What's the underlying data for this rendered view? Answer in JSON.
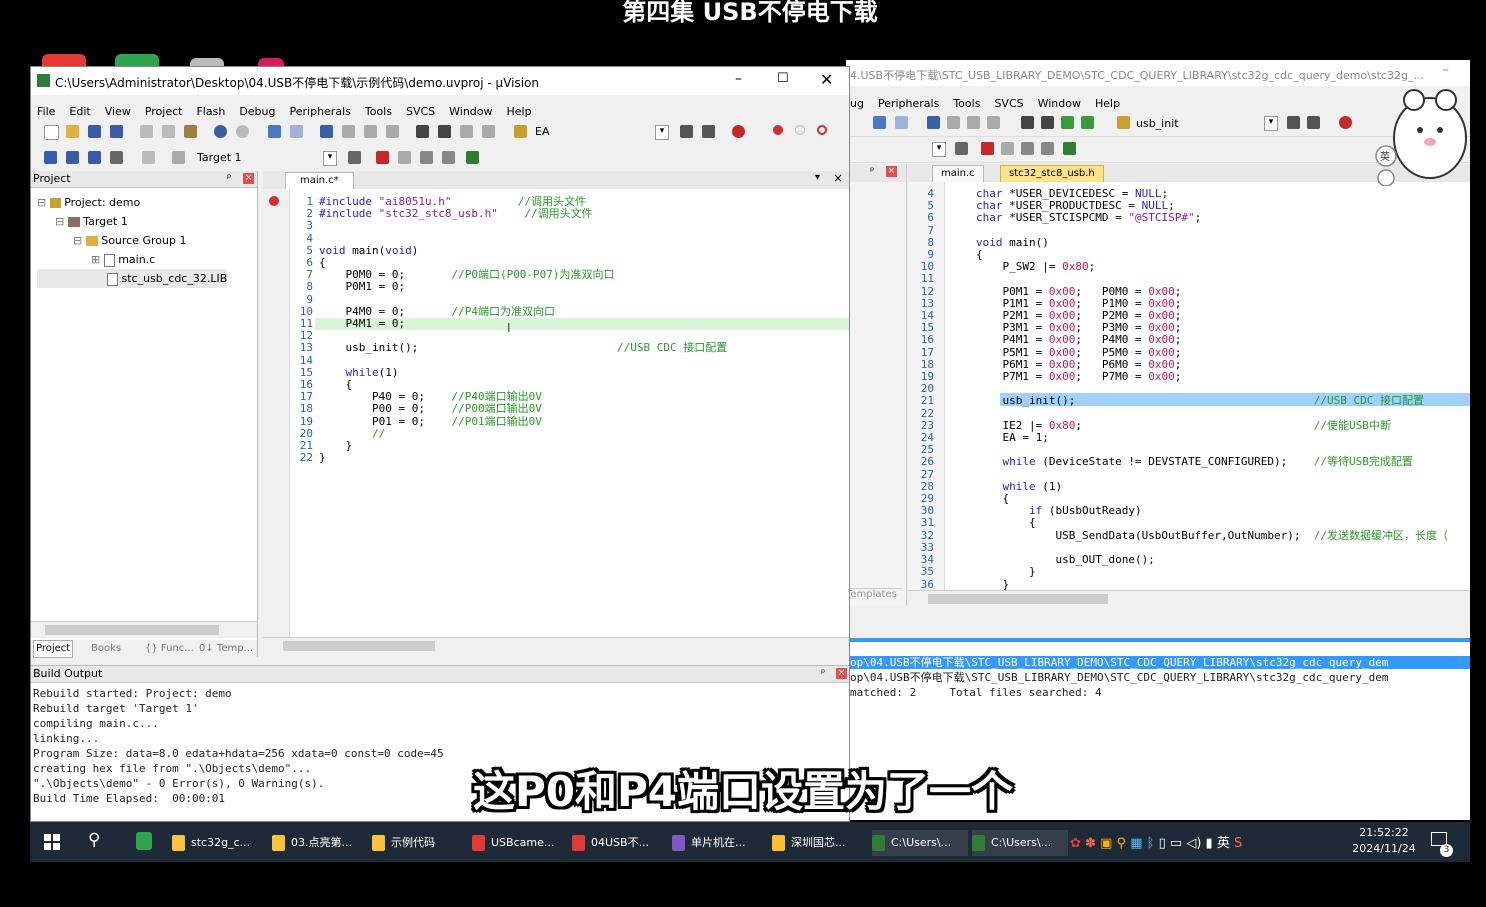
{
  "video_title": "第四集 USB不停电下载",
  "subtitle": "这P0和P4端口设置为了一个",
  "left_window": {
    "title": "C:\\Users\\Administrator\\Desktop\\04.USB不停电下载\\示例代码\\demo.uvproj - µVision",
    "menu": [
      "File",
      "Edit",
      "View",
      "Project",
      "Flash",
      "Debug",
      "Peripherals",
      "Tools",
      "SVCS",
      "Window",
      "Help"
    ],
    "toolbar_combo": "EA",
    "target_combo": "Target 1",
    "project_panel_title": "Project",
    "tree": [
      "Project: demo",
      "Target 1",
      "Source Group 1",
      "main.c",
      "stc_usb_cdc_32.LIB"
    ],
    "bottom_tabs": [
      "Project",
      "Books",
      "{} Func...",
      "0↓ Temp..."
    ],
    "editor_tab": "main.c*",
    "code_lines": [
      {
        "n": "1",
        "t": "#include \"ai8051u.h\"          //调用头文件"
      },
      {
        "n": "2",
        "t": "#include \"stc32_stc8_usb.h\"    //调用头文件"
      },
      {
        "n": "3",
        "t": ""
      },
      {
        "n": "4",
        "t": ""
      },
      {
        "n": "5",
        "t": "void main(void)"
      },
      {
        "n": "6",
        "t": "{"
      },
      {
        "n": "7",
        "t": "    P0M0 = 0;       //P0端口(P00-P07)为准双向口"
      },
      {
        "n": "8",
        "t": "    P0M1 = 0;"
      },
      {
        "n": "9",
        "t": ""
      },
      {
        "n": "10",
        "t": "    P4M0 = 0;       //P4端口为准双向口"
      },
      {
        "n": "11",
        "t": "    P4M1 = 0;"
      },
      {
        "n": "12",
        "t": ""
      },
      {
        "n": "13",
        "t": "    usb_init();                              //USB CDC 接口配置"
      },
      {
        "n": "14",
        "t": ""
      },
      {
        "n": "15",
        "t": "    while(1)"
      },
      {
        "n": "16",
        "t": "    {"
      },
      {
        "n": "17",
        "t": "        P40 = 0;    //P40端口输出0V"
      },
      {
        "n": "18",
        "t": "        P00 = 0;    //P00端口输出0V"
      },
      {
        "n": "19",
        "t": "        P01 = 0;    //P01端口输出0V"
      },
      {
        "n": "20",
        "t": "        //"
      },
      {
        "n": "21",
        "t": "    }"
      },
      {
        "n": "22",
        "t": "}"
      }
    ],
    "build_output_title": "Build Output",
    "build_output": [
      "Rebuild started: Project: demo",
      "Rebuild target 'Target 1'",
      "compiling main.c...",
      "linking...",
      "Program Size: data=8.0 edata+hdata=256 xdata=0 const=0 code=45",
      "creating hex file from \".\\Objects\\demo\"...",
      "\".\\Objects\\demo\" - 0 Error(s), 0 Warning(s).",
      "Build Time Elapsed:  00:00:01"
    ]
  },
  "right_window": {
    "title": "4.USB不停电下载\\STC_USB_LIBRARY_DEMO\\STC_CDC_QUERY_LIBRARY\\stc32g_cdc_query_demo\\stc32g_...",
    "menu": [
      "ug",
      "Peripherals",
      "Tools",
      "SVCS",
      "Window",
      "Help"
    ],
    "toolbar_combo": "usb_init",
    "tabs": [
      "main.c",
      "stc32_stc8_usb.h"
    ],
    "side_tab": "Templates",
    "code_lines": [
      {
        "n": "4",
        "t": "char *USER_DEVICEDESC = NULL;"
      },
      {
        "n": "5",
        "t": "char *USER_PRODUCTDESC = NULL;"
      },
      {
        "n": "6",
        "t": "char *USER_STCISPCMD = \"@STCISP#\";"
      },
      {
        "n": "7",
        "t": ""
      },
      {
        "n": "8",
        "t": "void main()"
      },
      {
        "n": "9",
        "t": "{"
      },
      {
        "n": "10",
        "t": "    P_SW2 |= 0x80;"
      },
      {
        "n": "11",
        "t": ""
      },
      {
        "n": "12",
        "t": "    P0M1 = 0x00;   P0M0 = 0x00;"
      },
      {
        "n": "13",
        "t": "    P1M1 = 0x00;   P1M0 = 0x00;"
      },
      {
        "n": "14",
        "t": "    P2M1 = 0x00;   P2M0 = 0x00;"
      },
      {
        "n": "15",
        "t": "    P3M1 = 0x00;   P3M0 = 0x00;"
      },
      {
        "n": "16",
        "t": "    P4M1 = 0x00;   P4M0 = 0x00;"
      },
      {
        "n": "17",
        "t": "    P5M1 = 0x00;   P5M0 = 0x00;"
      },
      {
        "n": "18",
        "t": "    P6M1 = 0x00;   P6M0 = 0x00;"
      },
      {
        "n": "19",
        "t": "    P7M1 = 0x00;   P7M0 = 0x00;"
      },
      {
        "n": "20",
        "t": ""
      },
      {
        "n": "21",
        "t": "    usb_init();                                    //USB CDC 接口配置"
      },
      {
        "n": "22",
        "t": ""
      },
      {
        "n": "23",
        "t": "    IE2 |= 0x80;                                   //使能USB中断"
      },
      {
        "n": "24",
        "t": "    EA = 1;"
      },
      {
        "n": "25",
        "t": ""
      },
      {
        "n": "26",
        "t": "    while (DeviceState != DEVSTATE_CONFIGURED);    //等待USB完成配置"
      },
      {
        "n": "27",
        "t": ""
      },
      {
        "n": "28",
        "t": "    while (1)"
      },
      {
        "n": "29",
        "t": "    {"
      },
      {
        "n": "30",
        "t": "        if (bUsbOutReady)"
      },
      {
        "n": "31",
        "t": "        {"
      },
      {
        "n": "32",
        "t": "            USB_SendData(UsbOutBuffer,OutNumber);  //发送数据缓冲区，长度（"
      },
      {
        "n": "33",
        "t": ""
      },
      {
        "n": "34",
        "t": "            usb_OUT_done();"
      },
      {
        "n": "35",
        "t": "        }"
      },
      {
        "n": "36",
        "t": "    }"
      }
    ],
    "find_output": [
      "op\\04.USB不停电下载\\STC_USB_LIBRARY_DEMO\\STC_CDC_QUERY_LIBRARY\\stc32g_cdc_query_dem",
      "op\\04.USB不停电下载\\STC_USB_LIBRARY_DEMO\\STC_CDC_QUERY_LIBRARY\\stc32g_cdc_query_dem",
      "matched: 2     Total files searched: 4"
    ],
    "side_badge": "英"
  },
  "taskbar": {
    "items": [
      "stc32g_c...",
      "03.点亮第...",
      "示例代码",
      "USBcame...",
      "04USB不...",
      "单片机在...",
      "深圳国芯...",
      "C:\\Users\\...",
      "C:\\Users\\..."
    ],
    "tray_lang": "英",
    "time": "21:52:22",
    "date": "2024/11/24",
    "notification_count": "3"
  },
  "colors": {
    "accent_blue": "#3399ff",
    "highlight_line": "#cfe8ff",
    "current_line": "#d8f5d8",
    "taskbar": "#1f2a38"
  }
}
